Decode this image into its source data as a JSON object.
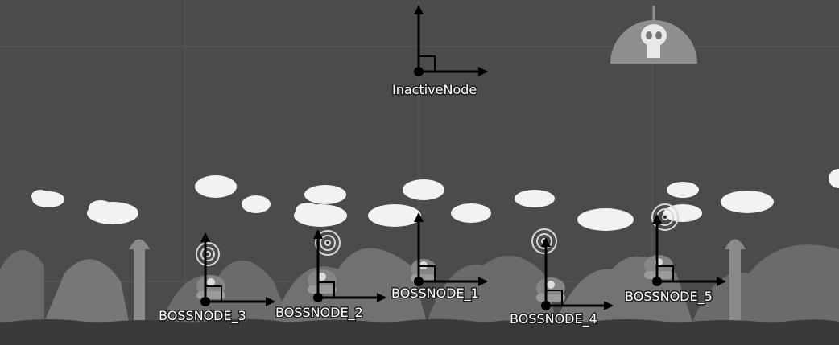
{
  "scene": {
    "nodes": [
      {
        "id": "inactive",
        "label": "InactiveNode"
      },
      {
        "id": "boss1",
        "label": "BOSSNODE_1"
      },
      {
        "id": "boss2",
        "label": "BOSSNODE_2"
      },
      {
        "id": "boss3",
        "label": "BOSSNODE_3"
      },
      {
        "id": "boss4",
        "label": "BOSSNODE_4"
      },
      {
        "id": "boss5",
        "label": "BOSSNODE_5"
      }
    ]
  },
  "icons": [
    "skull-dome-icon",
    "swirl-portal-icon",
    "tank-enemy-icon",
    "cloud-icon",
    "tower-icon",
    "hill-icon"
  ]
}
